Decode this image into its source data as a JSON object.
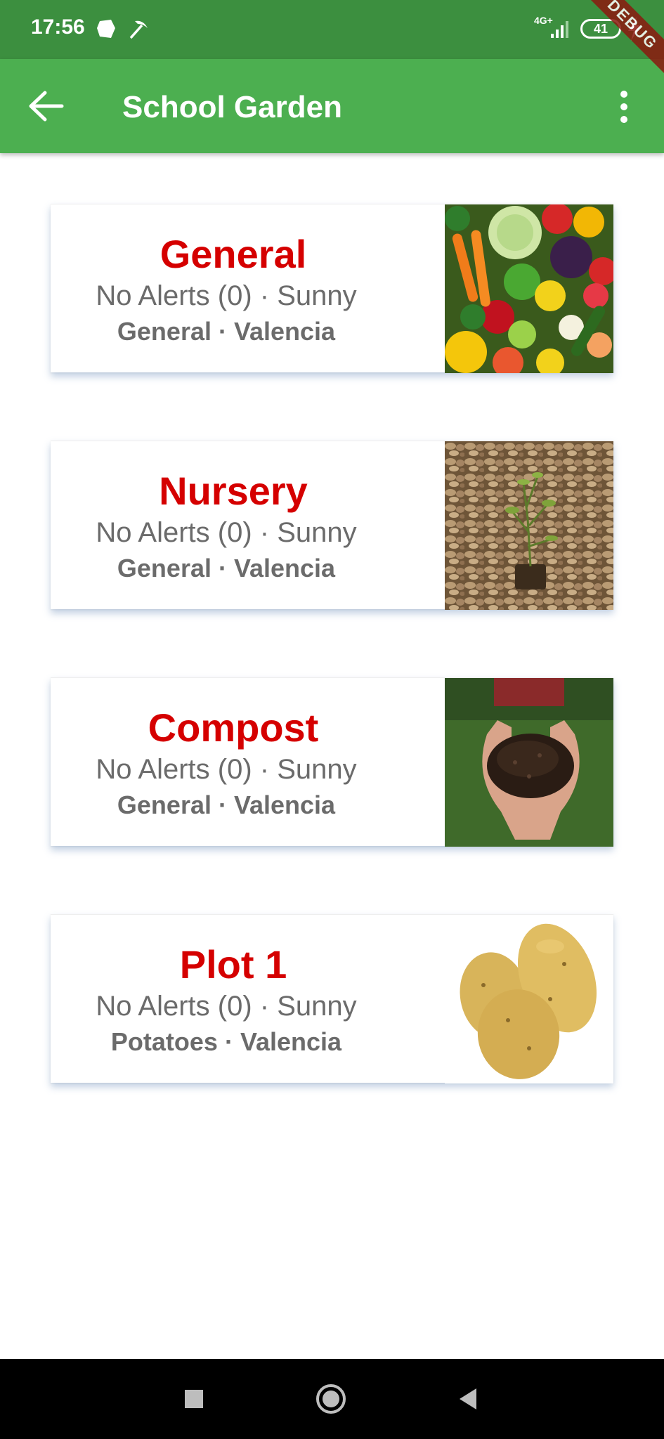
{
  "status_bar": {
    "time": "17:56",
    "network": "4G+",
    "battery": "41"
  },
  "debug_ribbon": "DEBUG",
  "app_bar": {
    "title": "School Garden"
  },
  "cards": [
    {
      "name": "General",
      "alerts": "No Alerts (0) · Sunny",
      "place": "General · Valencia",
      "image": "vegetables-photo"
    },
    {
      "name": "Nursery",
      "alerts": "No Alerts (0) · Sunny",
      "place": "General · Valencia",
      "image": "seedling-on-pebbles-photo"
    },
    {
      "name": "Compost",
      "alerts": "No Alerts (0) · Sunny",
      "place": "General · Valencia",
      "image": "hands-holding-compost-photo"
    },
    {
      "name": "Plot 1",
      "alerts": "No Alerts (0) · Sunny",
      "place": "Potatoes · Valencia",
      "image": "potatoes-photo"
    }
  ],
  "colors": {
    "status_bar": "#3c8f3f",
    "app_bar": "#4caf50",
    "card_title": "#d50000",
    "card_text": "#6b6b6b"
  }
}
